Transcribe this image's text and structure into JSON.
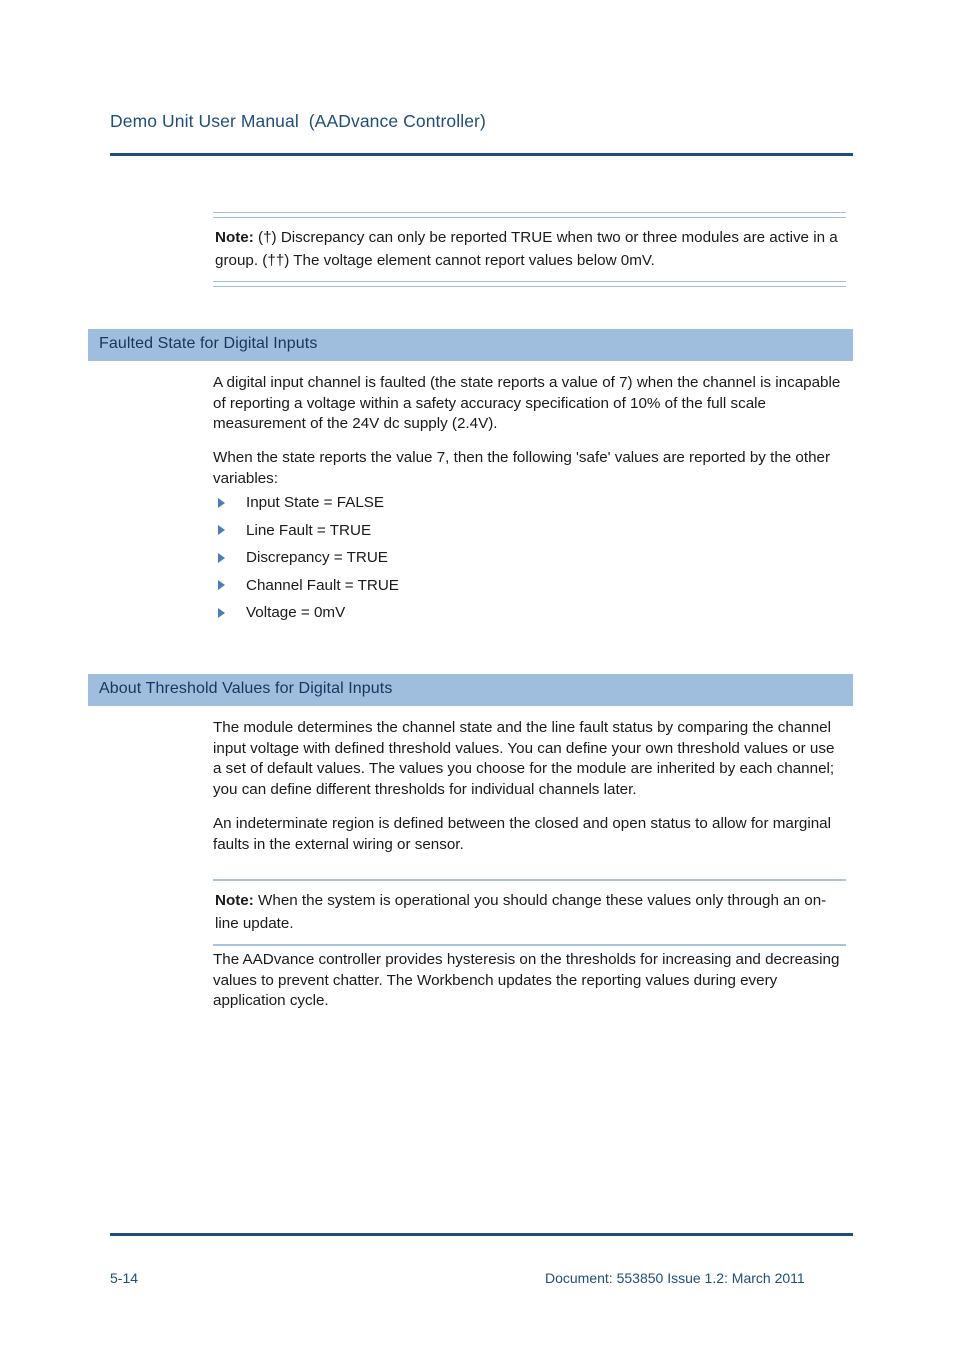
{
  "header": {
    "title": "Demo Unit User Manual  (AADvance Controller)",
    "rule_color": "#1F4E79"
  },
  "notes": {
    "top": {
      "label": "Note:",
      "text": " (†) Discrepancy can only be reported TRUE when two or three modules are active in a group. (††) The voltage element cannot report values below 0mV."
    },
    "middle": {
      "label": "Note:",
      "text": " When the system is operational you should change these values only through an on-line update."
    }
  },
  "sections": [
    {
      "heading": "Faulted State for Digital Inputs",
      "paragraphs": [
        "A digital input channel is faulted (the state reports a value of 7) when the channel is incapable of reporting a voltage within a safety accuracy specification of 10% of the full scale measurement of the 24V dc supply (2.4V).",
        "When the state reports the value 7, then the following 'safe' values are reported by the other variables:"
      ],
      "bullets": [
        "Input State = FALSE",
        "Line Fault = TRUE",
        "Discrepancy = TRUE",
        "Channel Fault = TRUE",
        "Voltage = 0mV"
      ]
    },
    {
      "heading": "About Threshold Values for Digital Inputs",
      "paragraphs": [
        "The module determines the channel state and the line fault status by comparing the channel input voltage with defined threshold values. You can define your own threshold values or use a set of default values. The values you choose for the module are inherited by each channel; you can define different thresholds for individual channels later.",
        "An indeterminate region is defined between the closed and open status to allow for marginal faults in the external wiring or sensor."
      ],
      "closing_paragraph": "The AADvance controller provides hysteresis on the thresholds for increasing and decreasing values to prevent chatter. The Workbench updates the reporting values during every application cycle."
    }
  ],
  "footer": {
    "page_number": "5-14",
    "document_info": "Document: 553850 Issue 1.2: March 2011"
  },
  "colors": {
    "header_text": "#1F4E79",
    "band_background": "#9FBDDD",
    "band_text": "#17365D",
    "bullet_marker": "#4A7EBB",
    "note_rule": "#9FC0DF"
  }
}
